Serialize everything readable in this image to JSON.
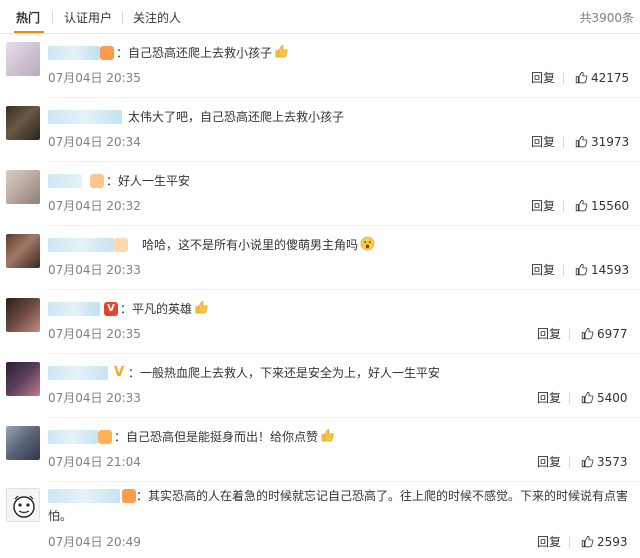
{
  "tabs": [
    {
      "label": "热门"
    },
    {
      "label": "认证用户"
    },
    {
      "label": "关注的人"
    }
  ],
  "total": "共3900条",
  "accent": "#ff8200",
  "comments": [
    {
      "text": "自己恐高还爬上去救小孩子",
      "emoji": "thumbs-up-icon",
      "time": "07月04日 20:35",
      "reply": "回复",
      "likes": "42175"
    },
    {
      "text": "太伟大了吧，自己恐高还爬上去救小孩子",
      "time": "07月04日 20:34",
      "reply": "回复",
      "likes": "31973"
    },
    {
      "text": "好人一生平安",
      "time": "07月04日 20:32",
      "reply": "回复",
      "likes": "15560"
    },
    {
      "text": "哈哈，这不是所有小说里的傻萌男主角吗",
      "emoji": "surprised-face-icon",
      "time": "07月04日 20:33",
      "reply": "回复",
      "likes": "14593"
    },
    {
      "text": "平凡的英雄",
      "emoji": "thumbs-up-icon",
      "time": "07月04日 20:35",
      "reply": "回复",
      "likes": "6977"
    },
    {
      "text": "一般热血爬上去救人，下来还是安全为上，好人一生平安",
      "time": "07月04日 20:33",
      "reply": "回复",
      "likes": "5400"
    },
    {
      "text": "自己恐高但是能挺身而出！给你点赞",
      "emoji": "thumbs-up-icon",
      "time": "07月04日 21:04",
      "reply": "回复",
      "likes": "3573"
    },
    {
      "text": "其实恐高的人在着急的时候就忘记自己恐高了。往上爬的时候不感觉。下来的时候说有点害怕。",
      "time": "07月04日 20:49",
      "reply": "回复",
      "likes": "2593"
    }
  ]
}
